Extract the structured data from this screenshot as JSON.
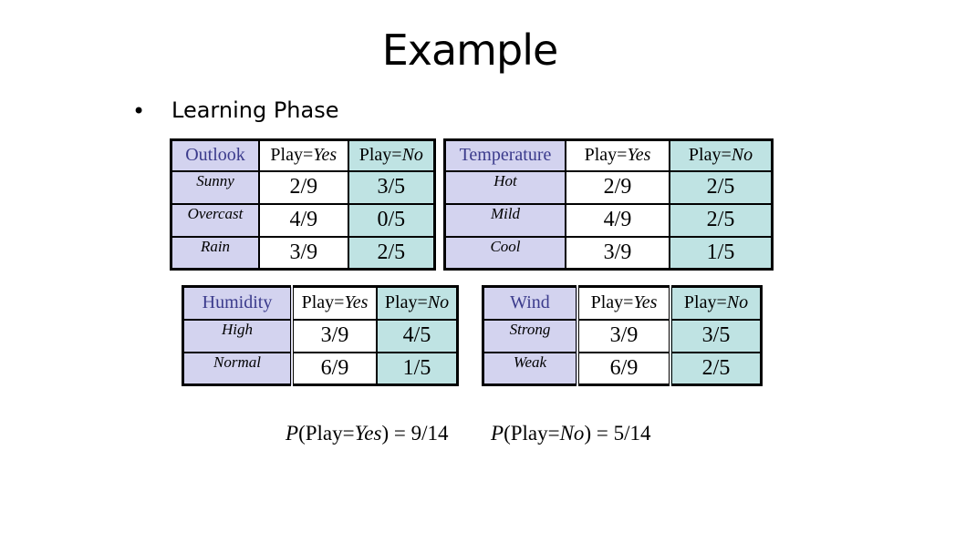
{
  "slide": {
    "title": "Example",
    "bullet": "Learning Phase"
  },
  "tables": {
    "outlook": {
      "attribute": "Outlook",
      "yes_prefix": "Play=",
      "yes_value": "Yes",
      "no_prefix": "Play=",
      "no_value": "No",
      "rows": [
        {
          "value": "Sunny",
          "yes": "2/9",
          "no": "3/5"
        },
        {
          "value": "Overcast",
          "yes": "4/9",
          "no": "0/5"
        },
        {
          "value": "Rain",
          "yes": "3/9",
          "no": "2/5"
        }
      ]
    },
    "temperature": {
      "attribute": "Temperature",
      "yes_prefix": "Play=",
      "yes_value": "Yes",
      "no_prefix": "Play=",
      "no_value": "No",
      "rows": [
        {
          "value": "Hot",
          "yes": "2/9",
          "no": "2/5"
        },
        {
          "value": "Mild",
          "yes": "4/9",
          "no": "2/5"
        },
        {
          "value": "Cool",
          "yes": "3/9",
          "no": "1/5"
        }
      ]
    },
    "humidity": {
      "attribute": "Humidity",
      "yes_prefix": "Play=",
      "yes_value": "Yes",
      "no_prefix": "Play=",
      "no_value": "No",
      "rows": [
        {
          "value": "High",
          "yes": "3/9",
          "no": "4/5"
        },
        {
          "value": "Normal",
          "yes": "6/9",
          "no": "1/5"
        }
      ]
    },
    "wind": {
      "attribute": "Wind",
      "yes_prefix": "Play=",
      "yes_value": "Yes",
      "no_prefix": "Play=",
      "no_value": "No",
      "rows": [
        {
          "value": "Strong",
          "yes": "3/9",
          "no": "3/5"
        },
        {
          "value": "Weak",
          "yes": "6/9",
          "no": "2/5"
        }
      ]
    }
  },
  "priors": {
    "yes": {
      "p": "P",
      "open": "(Play=",
      "label": "Yes",
      "close": ") = 9/14"
    },
    "no": {
      "p": "P",
      "open": "(Play=",
      "label": "No",
      "close": ") = 5/14"
    }
  },
  "colors": {
    "attribute_column": "#d3d3ef",
    "no_column": "#bfe3e3",
    "attribute_header_text": "#3b3b8c"
  }
}
